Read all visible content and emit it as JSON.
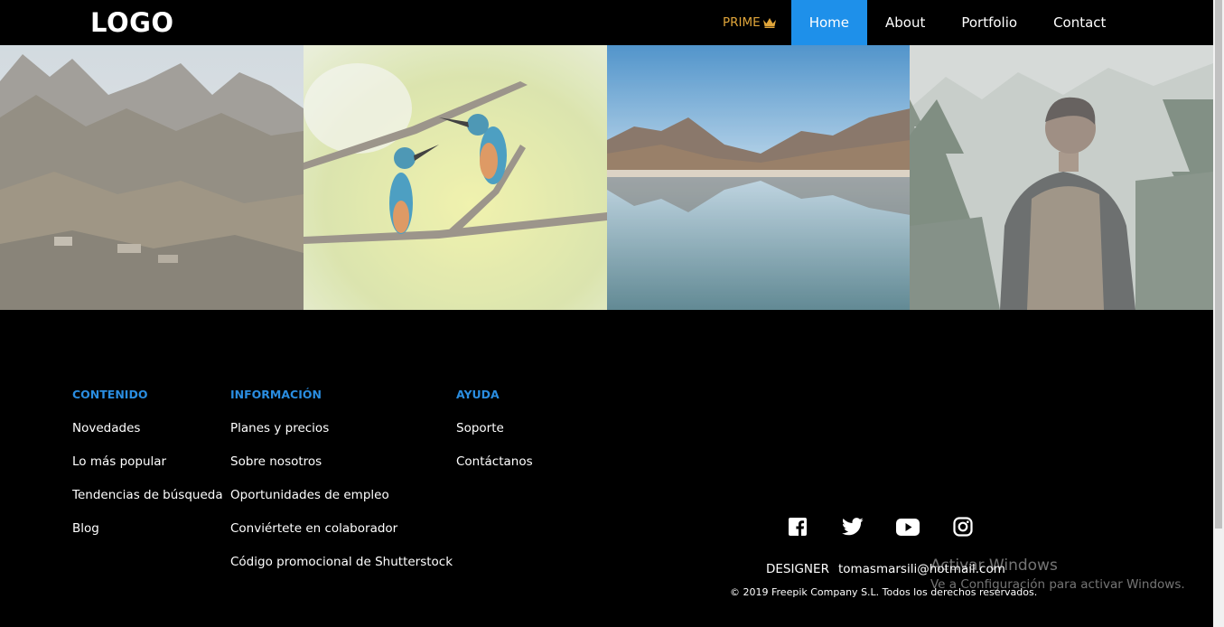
{
  "header": {
    "logo": "LOGO",
    "prime_label": "PRIME",
    "prime_icon": "crown-icon",
    "nav": [
      {
        "label": "Home",
        "active": true
      },
      {
        "label": "About",
        "active": false
      },
      {
        "label": "Portfolio",
        "active": false
      },
      {
        "label": "Contact",
        "active": false
      }
    ]
  },
  "gallery": {
    "photos": [
      "mountain-village-photo",
      "kingfisher-birds-photo",
      "mountain-lake-photo",
      "hiker-forest-photo"
    ]
  },
  "footer": {
    "columns": [
      {
        "title": "CONTENIDO",
        "links": [
          "Novedades",
          "Lo más popular",
          "Tendencias de búsqueda",
          "Blog"
        ]
      },
      {
        "title": "INFORMACIÓN",
        "links": [
          "Planes y precios",
          "Sobre nosotros",
          "Oportunidades de empleo",
          "Conviértete en colaborador",
          "Código promocional de Shutterstock"
        ]
      },
      {
        "title": "AYUDA",
        "links": [
          "Soporte",
          "Contáctanos"
        ]
      }
    ],
    "socials": [
      "facebook-icon",
      "twitter-icon",
      "youtube-icon",
      "instagram-icon"
    ],
    "designer_label": "DESIGNER",
    "designer_email": "tomasmarsili@hotmail.com",
    "copyright": "© 2019 Freepik Company S.L. Todos los derechos reservados."
  },
  "watermark": {
    "title": "Activar Windows",
    "subtitle": "Ve a Configuración para activar Windows."
  },
  "colors": {
    "accent": "#1e90ea",
    "footer_heading": "#2a8de0",
    "prime": "#e0a53a",
    "background": "#000000"
  }
}
